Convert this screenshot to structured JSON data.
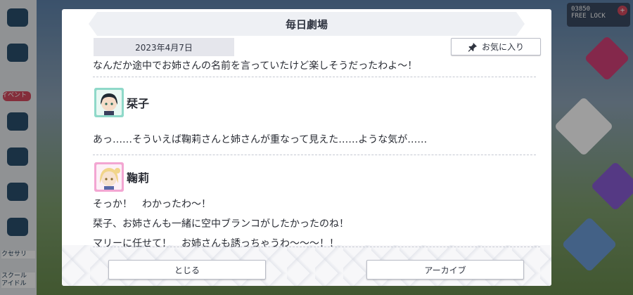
{
  "background": {
    "sidebar_labels": [
      "イベント",
      "クセサリ",
      "スクール\nアイドル"
    ],
    "counter": {
      "value": "03850",
      "sub": "FREE LOCK"
    }
  },
  "modal": {
    "title": "毎日劇場",
    "date": "2023年4月7日",
    "favorite_label": "お気に入り",
    "cut_line": "なんだか途中でお姉さんの名前を言っていたけど楽しそうだったわよ〜！",
    "entries": [
      {
        "speaker": "栞子",
        "lines": [
          "あっ……そういえば鞠莉さんと姉さんが重なって見えた……ような気が……"
        ]
      },
      {
        "speaker": "鞠莉",
        "lines": [
          "そっか！　わかったわ〜！",
          "栞子、お姉さんも一緒に空中ブランコがしたかったのね！",
          "マリーに任せて！　お姉さんも誘っちゃうわ〜〜〜！！"
        ]
      }
    ],
    "close_label": "とじる",
    "archive_label": "アーカイブ"
  },
  "colors": {
    "accent_scroll": "#f07c8c",
    "avatar_shioriko_bg": "#8fd9c9",
    "avatar_mari_bg": "#f3a6d2"
  },
  "icons": {
    "favorite": "pin-icon"
  }
}
